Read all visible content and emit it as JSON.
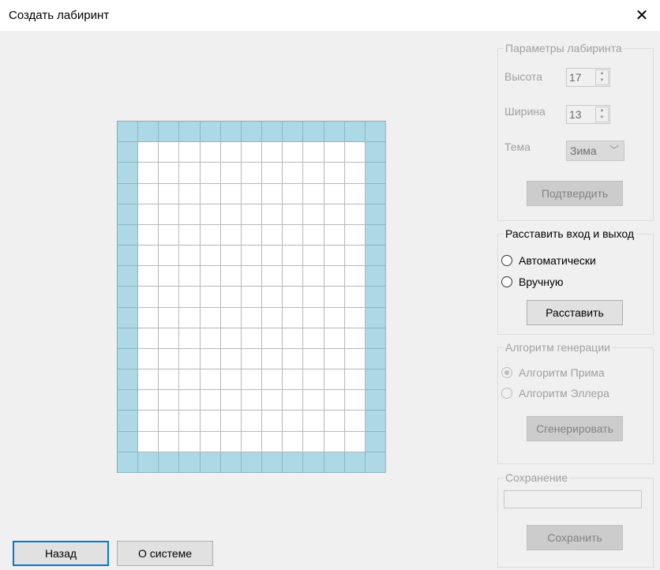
{
  "window": {
    "title": "Создать лабиринт",
    "close_glyph": "✕"
  },
  "maze": {
    "rows": 17,
    "cols": 13,
    "wall_color": "#add8e6",
    "floor_color": "#ffffff"
  },
  "params": {
    "legend": "Параметры лабиринта",
    "height_label": "Высота",
    "height_value": "17",
    "width_label": "Ширина",
    "width_value": "13",
    "theme_label": "Тема",
    "theme_value": "Зима",
    "confirm_label": "Подтвердить"
  },
  "entry_exit": {
    "legend": "Расставить вход и выход",
    "auto_label": "Автоматически",
    "manual_label": "Вручную",
    "place_label": "Расставить"
  },
  "algorithm": {
    "legend": "Алгоритм генерации",
    "prim_label": "Алгоритм Прима",
    "eller_label": "Алгоритм Эллера",
    "generate_label": "Сгенерировать"
  },
  "save": {
    "legend": "Сохранение",
    "filename_value": "",
    "save_label": "Сохранить"
  },
  "footer": {
    "back_label": "Назад",
    "about_label": "О системе"
  }
}
